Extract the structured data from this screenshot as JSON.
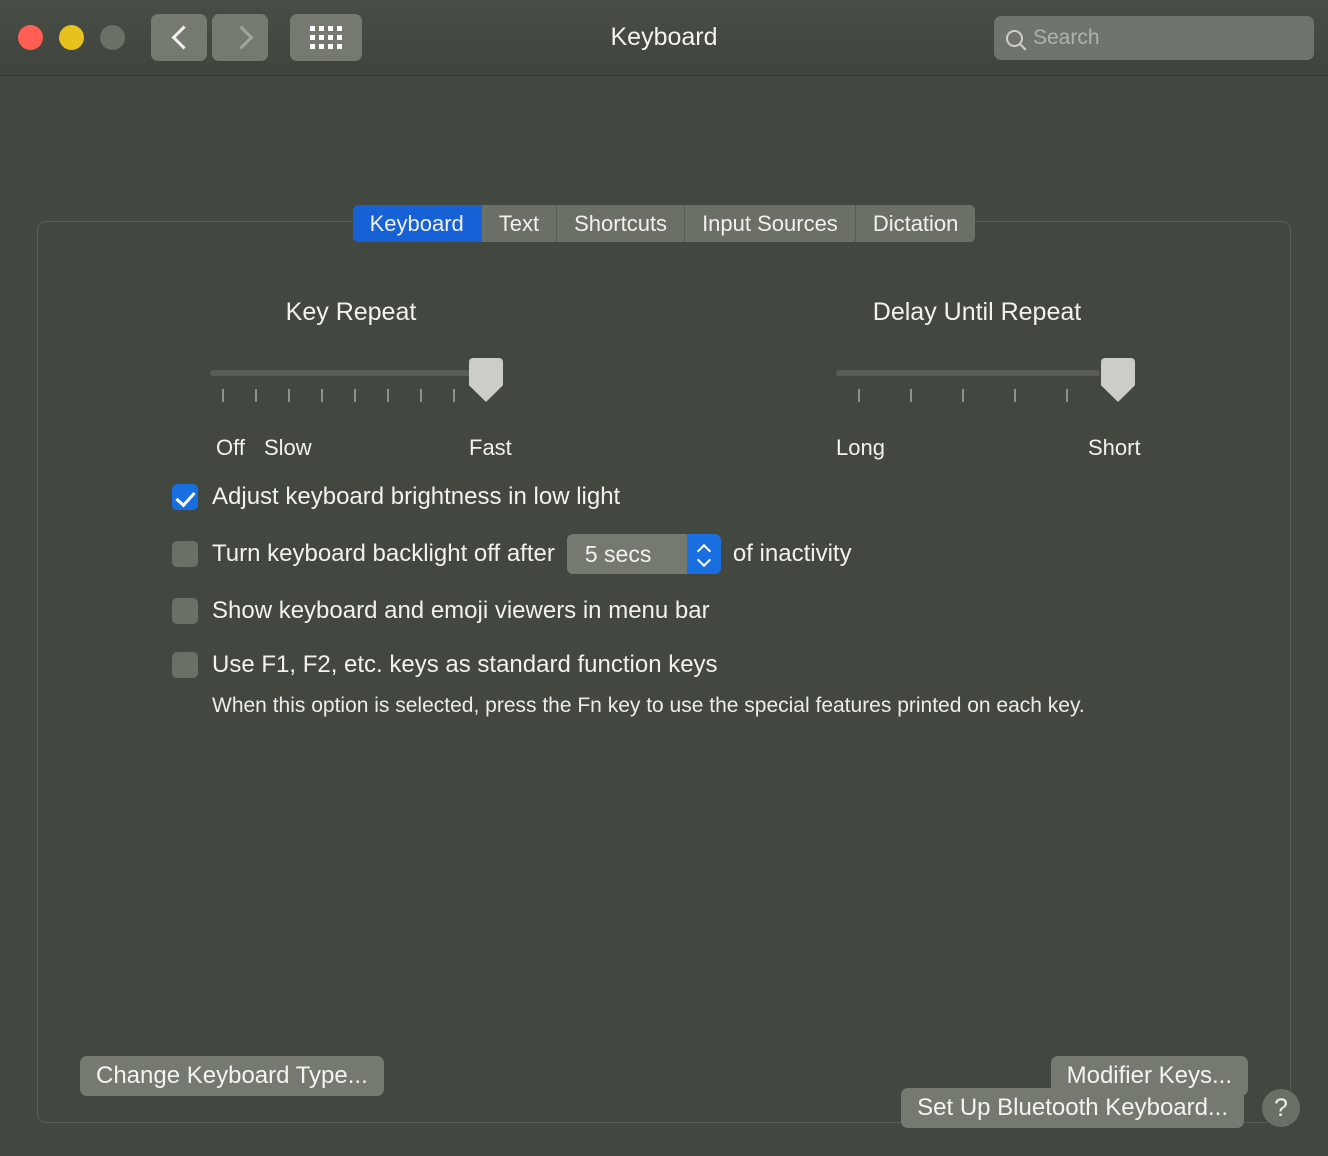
{
  "window": {
    "title": "Keyboard",
    "traffic_lights": [
      "close",
      "minimize",
      "zoom"
    ],
    "nav": {
      "back_icon": "chevron-left-icon",
      "forward_icon": "chevron-right-icon",
      "grid_icon": "grid-all-preferences-icon"
    }
  },
  "search": {
    "placeholder": "Search",
    "value": "",
    "icon": "search-icon"
  },
  "tabs": [
    {
      "label": "Keyboard",
      "active": true
    },
    {
      "label": "Text",
      "active": false
    },
    {
      "label": "Shortcuts",
      "active": false
    },
    {
      "label": "Input Sources",
      "active": false
    },
    {
      "label": "Dictation",
      "active": false
    }
  ],
  "sliders": [
    {
      "title": "Key Repeat",
      "left_label": "Off",
      "second_label": "Slow",
      "right_label": "Fast",
      "ticks": 9,
      "value_index": 8
    },
    {
      "title": "Delay Until Repeat",
      "left_label": "Long",
      "second_label": "",
      "right_label": "Short",
      "ticks": 6,
      "value_index": 5
    }
  ],
  "options": [
    {
      "label": "Adjust keyboard brightness in low light",
      "checked": true
    },
    {
      "label": "Turn keyboard backlight off after",
      "checked": false,
      "suffix": "of inactivity",
      "stepper": {
        "value": "5 secs",
        "up_icon": "chevron-up-icon",
        "down_icon": "chevron-down-icon"
      }
    },
    {
      "label": "Show keyboard and emoji viewers in menu bar",
      "checked": false
    },
    {
      "label": "Use F1, F2, etc. keys as standard function keys",
      "checked": false,
      "help": "When this option is selected, press the Fn key to use the special features printed on each key."
    }
  ],
  "buttons": {
    "change_keyboard_type": "Change Keyboard Type...",
    "modifier_keys": "Modifier Keys...",
    "set_up_bluetooth": "Set Up Bluetooth Keyboard...",
    "help": "?"
  },
  "colors": {
    "accent_blue": "#1761d7",
    "checkbox_blue": "#1a6fe0",
    "background": "#424740",
    "control_gray": "#757a71",
    "close_red": "#ff5f52",
    "min_yellow": "#e8c21c",
    "zoom_gray": "#6b7067"
  }
}
